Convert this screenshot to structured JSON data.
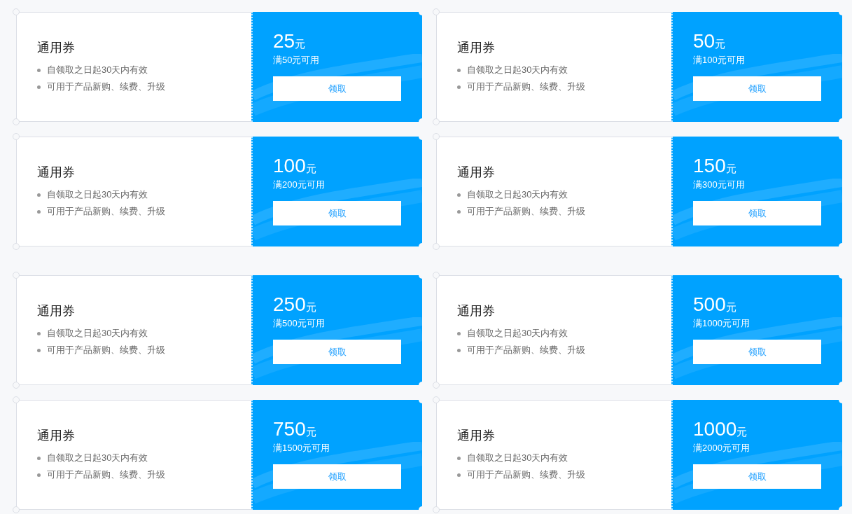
{
  "groups": [
    {
      "coupons": [
        {
          "title": "通用券",
          "terms": [
            "自领取之日起30天内有效",
            "可用于产品新购、续费、升级"
          ],
          "amount": "25",
          "unit": "元",
          "condition": "满50元可用",
          "button": "领取"
        },
        {
          "title": "通用券",
          "terms": [
            "自领取之日起30天内有效",
            "可用于产品新购、续费、升级"
          ],
          "amount": "50",
          "unit": "元",
          "condition": "满100元可用",
          "button": "领取"
        },
        {
          "title": "通用券",
          "terms": [
            "自领取之日起30天内有效",
            "可用于产品新购、续费、升级"
          ],
          "amount": "100",
          "unit": "元",
          "condition": "满200元可用",
          "button": "领取"
        },
        {
          "title": "通用券",
          "terms": [
            "自领取之日起30天内有效",
            "可用于产品新购、续费、升级"
          ],
          "amount": "150",
          "unit": "元",
          "condition": "满300元可用",
          "button": "领取"
        }
      ]
    },
    {
      "coupons": [
        {
          "title": "通用券",
          "terms": [
            "自领取之日起30天内有效",
            "可用于产品新购、续费、升级"
          ],
          "amount": "250",
          "unit": "元",
          "condition": "满500元可用",
          "button": "领取"
        },
        {
          "title": "通用券",
          "terms": [
            "自领取之日起30天内有效",
            "可用于产品新购、续费、升级"
          ],
          "amount": "500",
          "unit": "元",
          "condition": "满1000元可用",
          "button": "领取"
        },
        {
          "title": "通用券",
          "terms": [
            "自领取之日起30天内有效",
            "可用于产品新购、续费、升级"
          ],
          "amount": "750",
          "unit": "元",
          "condition": "满1500元可用",
          "button": "领取"
        },
        {
          "title": "通用券",
          "terms": [
            "自领取之日起30天内有效",
            "可用于产品新购、续费、升级"
          ],
          "amount": "1000",
          "unit": "元",
          "condition": "满2000元可用",
          "button": "领取"
        }
      ]
    }
  ]
}
